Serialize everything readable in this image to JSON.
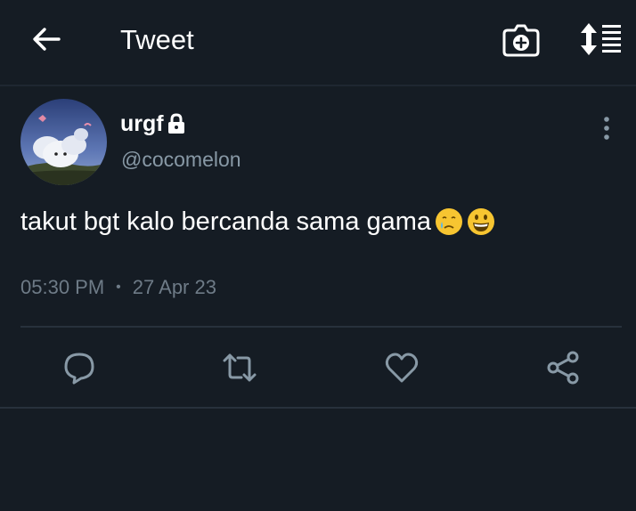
{
  "header": {
    "title": "Tweet",
    "back_icon": "arrow-left-icon",
    "camera_icon": "camera-plus-icon",
    "reorder_icon": "sort-list-icon"
  },
  "tweet": {
    "author": {
      "display_name": "urgf",
      "handle": "@cocomelon",
      "protected_icon": "lock-icon"
    },
    "text": "takut bgt kalo bercanda sama gama",
    "emojis": [
      "face-holding-back-tears",
      "grinning-face"
    ],
    "time": "05:30 PM",
    "separator": "•",
    "date": "27 Apr 23",
    "more_icon": "more-vertical-icon"
  },
  "actions": [
    {
      "name": "reply",
      "icon": "reply-icon"
    },
    {
      "name": "retweet",
      "icon": "retweet-icon"
    },
    {
      "name": "like",
      "icon": "heart-icon"
    },
    {
      "name": "share",
      "icon": "share-icon"
    }
  ],
  "colors": {
    "background": "#151c24",
    "text": "#ffffff",
    "secondary_text": "#8899a6",
    "icon_gray": "#8899a6",
    "divider": "#27313c"
  }
}
